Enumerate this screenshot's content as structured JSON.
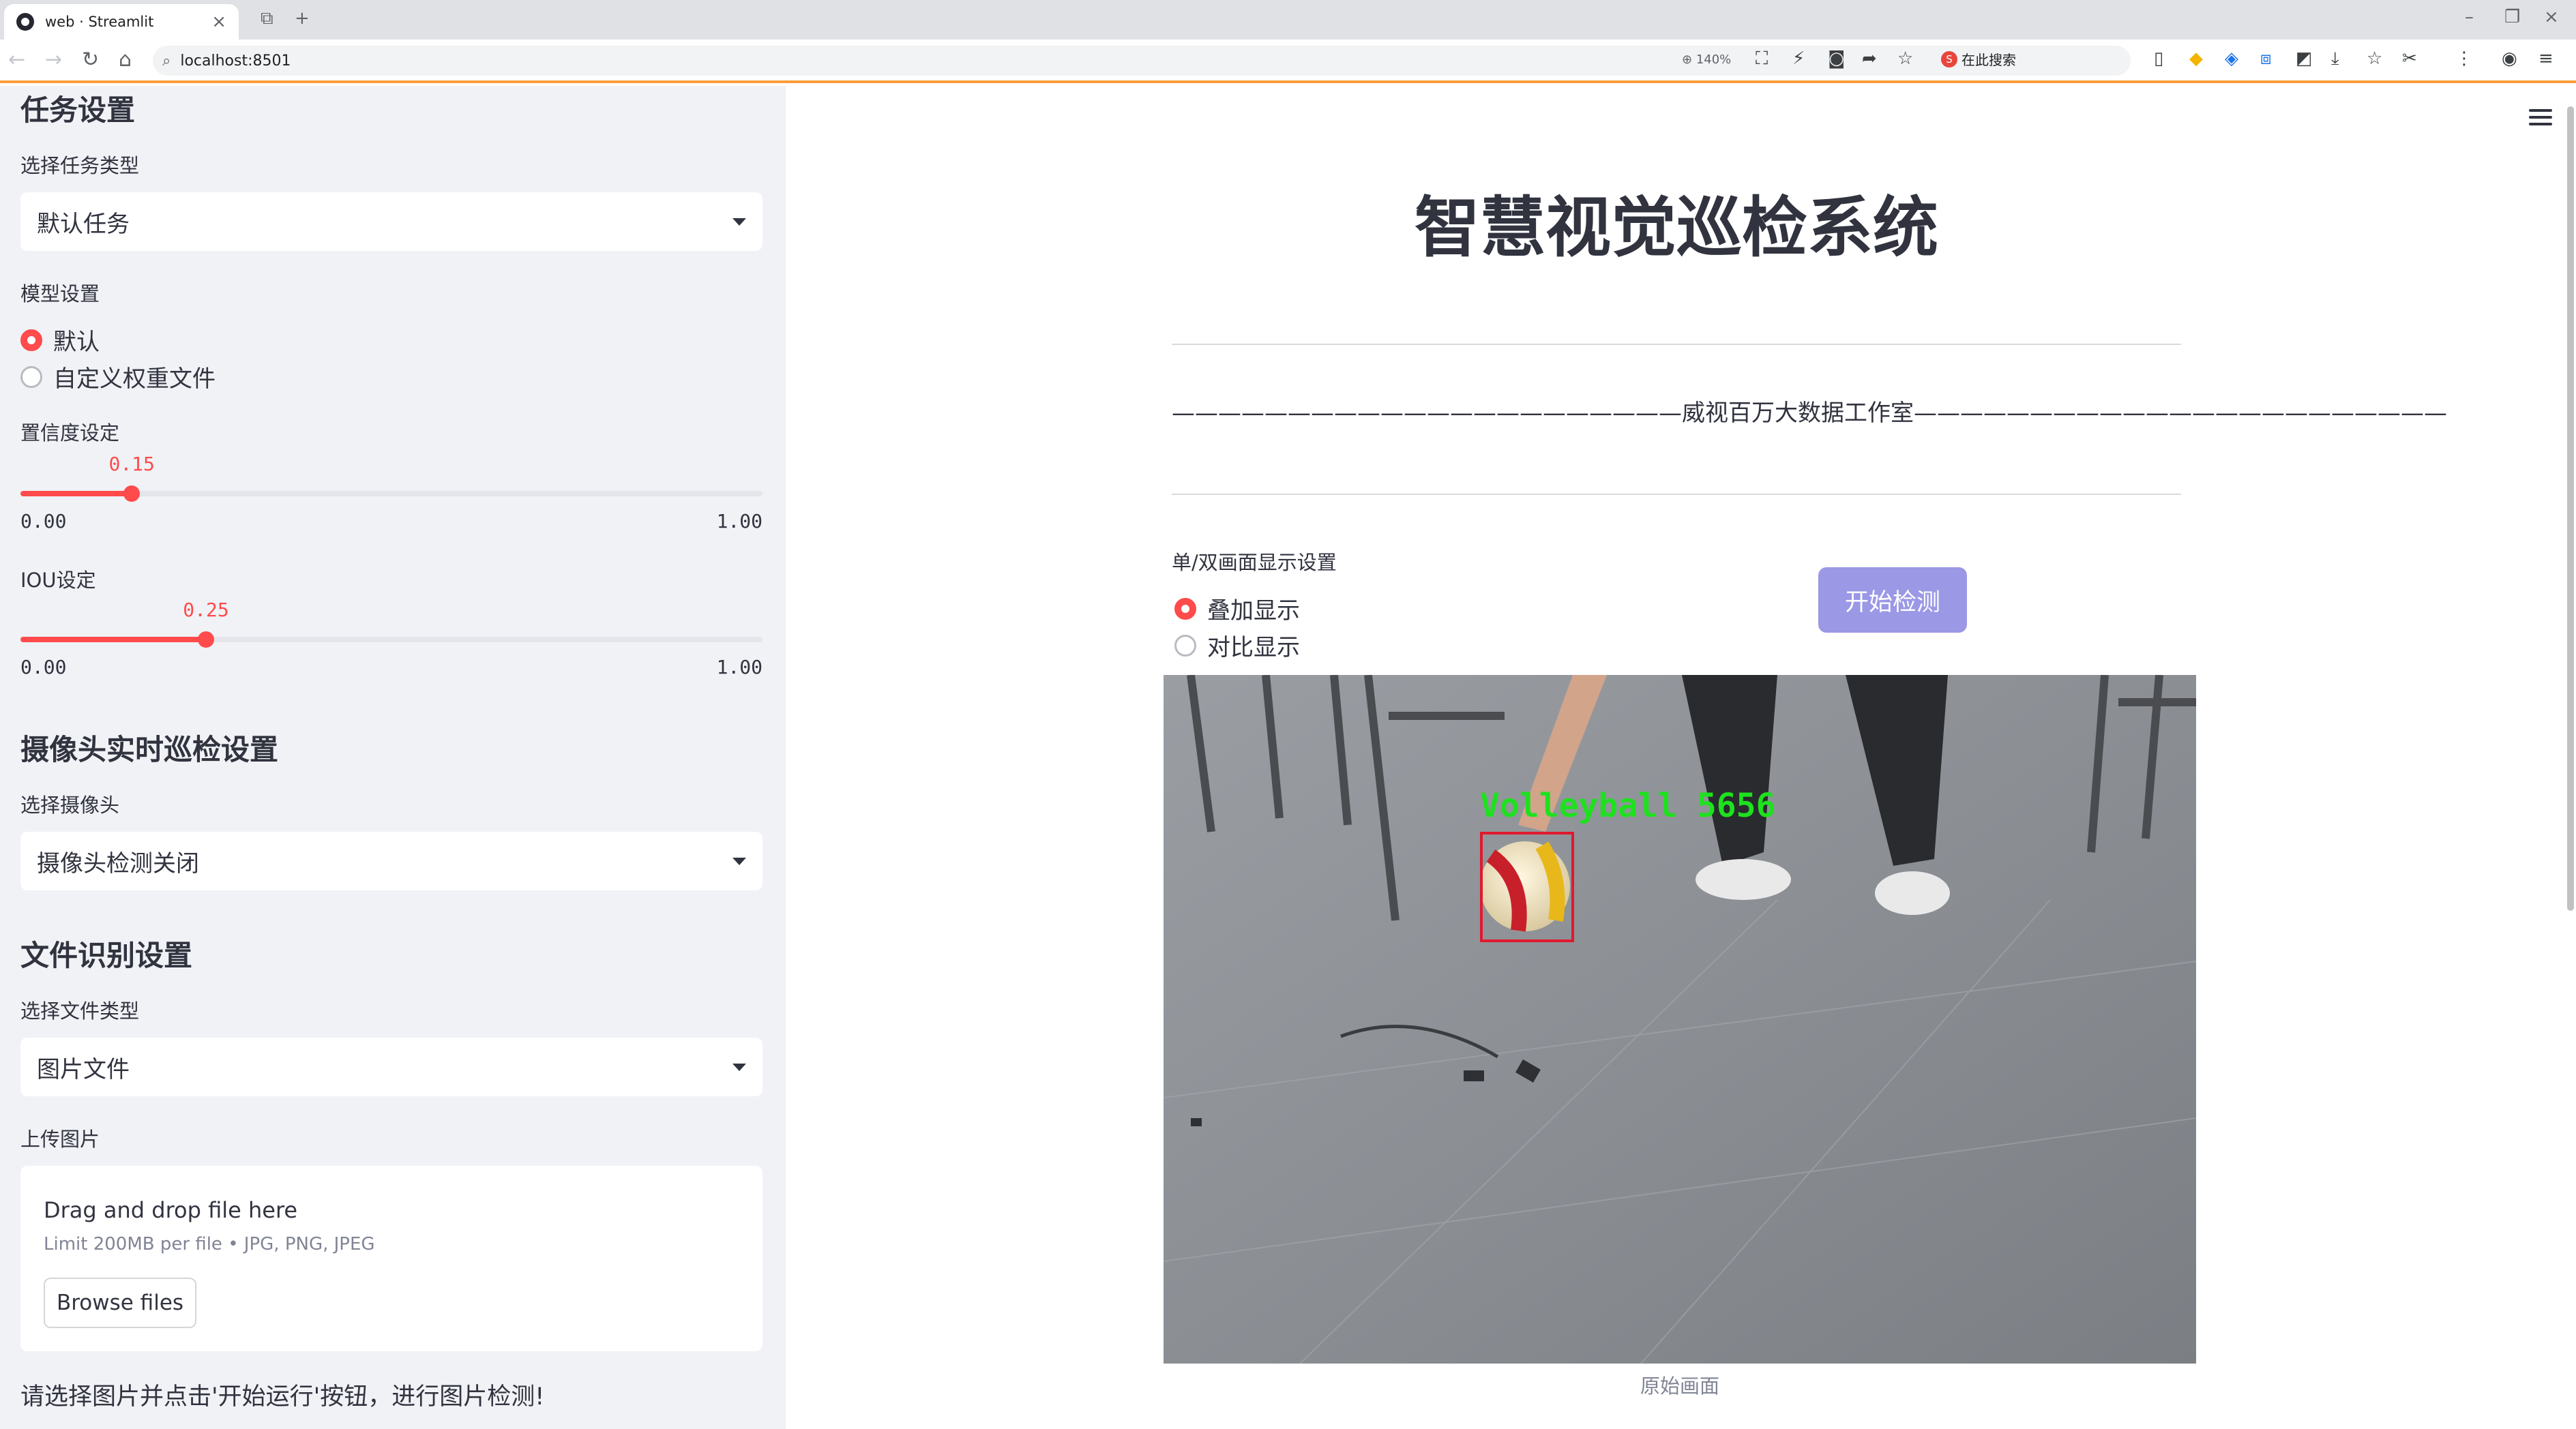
{
  "browser": {
    "tab_title": "web · Streamlit",
    "url": "localhost:8501",
    "zoom": "140%",
    "search_engine_label": "在此搜索"
  },
  "sidebar": {
    "task_section_title": "任务设置",
    "task_type_label": "选择任务类型",
    "task_type_value": "默认任务",
    "model_label": "模型设置",
    "model_options": [
      "默认",
      "自定义权重文件"
    ],
    "model_selected": 0,
    "confidence_label": "置信度设定",
    "confidence": {
      "value": 0.15,
      "value_text": "0.15",
      "min_text": "0.00",
      "max_text": "1.00",
      "min": 0,
      "max": 1
    },
    "iou_label": "IOU设定",
    "iou": {
      "value": 0.25,
      "value_text": "0.25",
      "min_text": "0.00",
      "max_text": "1.00",
      "min": 0,
      "max": 1
    },
    "camera_section_title": "摄像头实时巡检设置",
    "camera_label": "选择摄像头",
    "camera_value": "摄像头检测关闭",
    "file_section_title": "文件识别设置",
    "file_type_label": "选择文件类型",
    "file_type_value": "图片文件",
    "upload_label": "上传图片",
    "upload": {
      "drop_text": "Drag and drop file here",
      "limit_text": "Limit 200MB per file • JPG, PNG, JPEG",
      "browse_label": "Browse files"
    },
    "footer_hint": "请选择图片并点击'开始运行'按钮，进行图片检测!"
  },
  "main": {
    "title": "智慧视觉巡检系统",
    "studio_line": "——————————————————————威视百万大数据工作室———————————————————————",
    "display_label": "单/双画面显示设置",
    "display_options": [
      "叠加显示",
      "对比显示"
    ],
    "display_selected": 0,
    "start_button": "开始检测",
    "detection_label": "Volleyball 5656",
    "caption": "原始画面"
  },
  "colors": {
    "accent": "#ff4b4b",
    "start_button": "#9b98e6",
    "sidebar_bg": "#f0f2f6",
    "detection_box": "#e0192e",
    "detection_text": "#1ee11e"
  }
}
